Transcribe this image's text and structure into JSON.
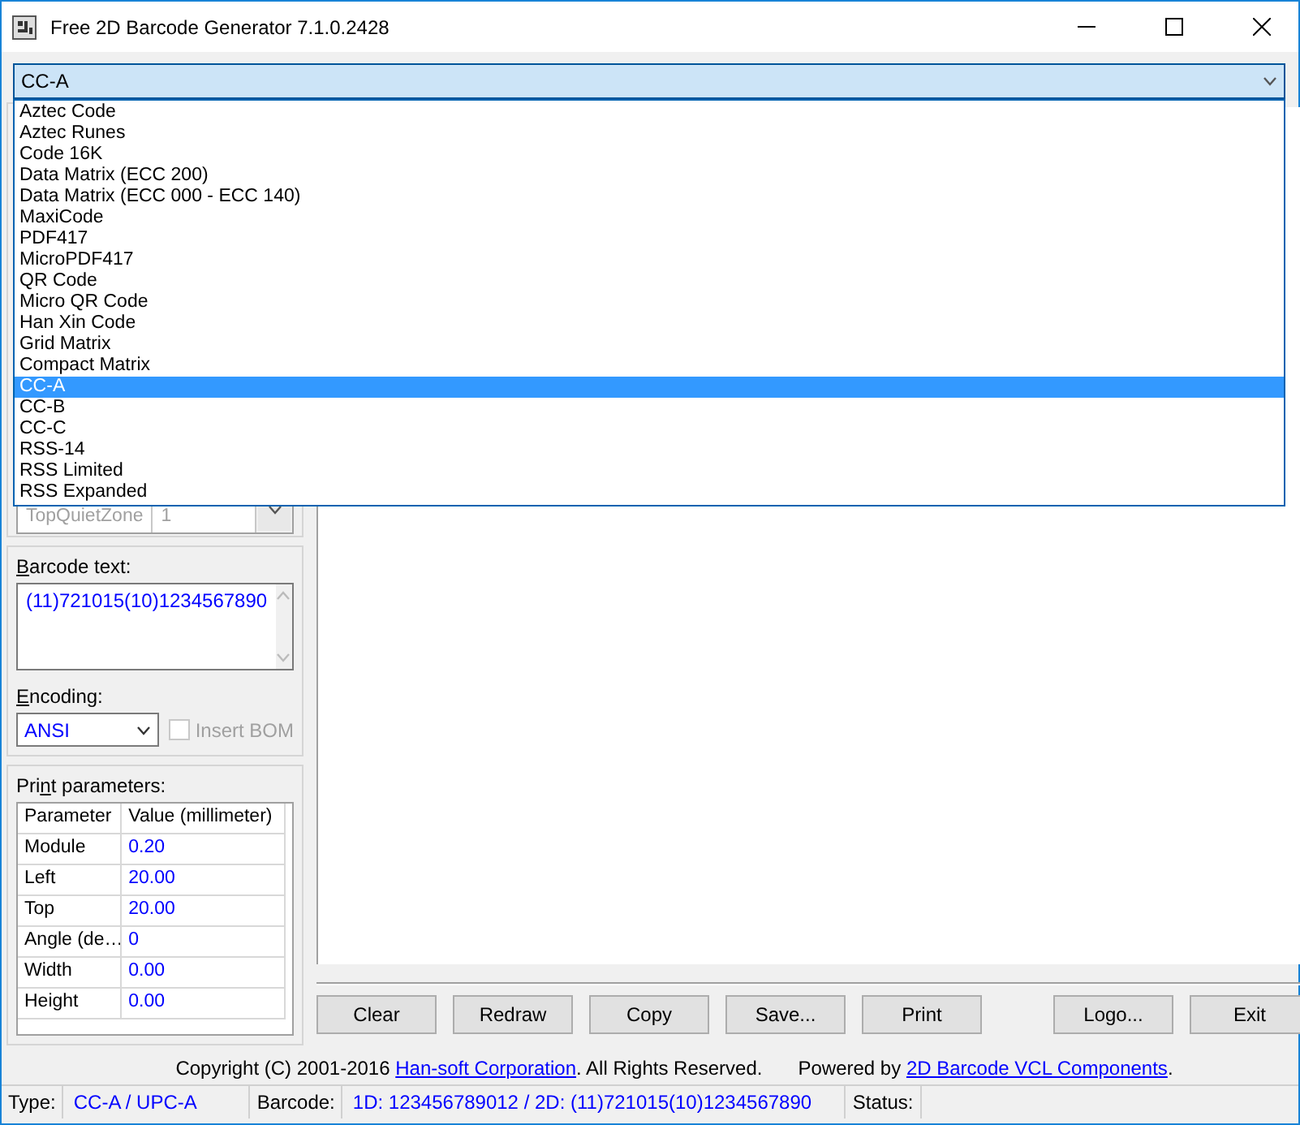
{
  "window": {
    "title": "Free 2D Barcode Generator 7.1.0.2428"
  },
  "barcode_type": {
    "value": "CC-A",
    "options": [
      {
        "label": "Aztec Code",
        "selected": false
      },
      {
        "label": "Aztec Runes",
        "selected": false
      },
      {
        "label": "Code 16K",
        "selected": false
      },
      {
        "label": "Data Matrix (ECC 200)",
        "selected": false
      },
      {
        "label": "Data Matrix (ECC 000 - ECC 140)",
        "selected": false
      },
      {
        "label": "MaxiCode",
        "selected": false
      },
      {
        "label": "PDF417",
        "selected": false
      },
      {
        "label": "MicroPDF417",
        "selected": false
      },
      {
        "label": "QR Code",
        "selected": false
      },
      {
        "label": "Micro QR Code",
        "selected": false
      },
      {
        "label": "Han Xin Code",
        "selected": false
      },
      {
        "label": "Grid Matrix",
        "selected": false
      },
      {
        "label": "Compact Matrix",
        "selected": false
      },
      {
        "label": "CC-A",
        "selected": true
      },
      {
        "label": "CC-B",
        "selected": false
      },
      {
        "label": "CC-C",
        "selected": false
      },
      {
        "label": "RSS-14",
        "selected": false
      },
      {
        "label": "RSS Limited",
        "selected": false
      },
      {
        "label": "RSS Expanded",
        "selected": false
      }
    ]
  },
  "symbology_grid": {
    "rows": [
      {
        "name": "TopQuietZone",
        "value": "1"
      }
    ]
  },
  "barcode_text": {
    "label": [
      {
        "text": "B",
        "underlined": true
      },
      {
        "text": "arcode text:",
        "underlined": false
      }
    ],
    "value": "(11)721015(10)1234567890"
  },
  "encoding": {
    "label": [
      {
        "text": "E",
        "underlined": true
      },
      {
        "text": "ncoding:",
        "underlined": false
      }
    ],
    "value": "ANSI",
    "insert_bom": {
      "label": "Insert BOM",
      "checked": false,
      "disabled": true
    }
  },
  "print_parameters": {
    "label": [
      {
        "text": "Pri",
        "underlined": false
      },
      {
        "text": "n",
        "underlined": true
      },
      {
        "text": "t parameters:",
        "underlined": false
      }
    ],
    "columns": [
      "Parameter",
      "Value (millimeter)"
    ],
    "rows": [
      [
        "Module",
        "0.20"
      ],
      [
        "Left",
        "20.00"
      ],
      [
        "Top",
        "20.00"
      ],
      [
        "Angle (de…",
        "0"
      ],
      [
        "Width",
        "0.00"
      ],
      [
        "Height",
        "0.00"
      ]
    ]
  },
  "buttons": [
    {
      "label": "Clear",
      "disabled": false
    },
    {
      "label": "Redraw",
      "disabled": false
    },
    {
      "label": "Copy",
      "disabled": false
    },
    {
      "label": "Save...",
      "disabled": false
    },
    {
      "label": "Print",
      "disabled": false
    },
    {
      "label": "Logo...",
      "disabled": false
    },
    {
      "label": "Exit",
      "disabled": false
    }
  ],
  "copyright": {
    "before": "Copyright (C) 2001-2016",
    "link": "Han-soft Corporation",
    "after": ". All Rights Reserved."
  },
  "powered_by": {
    "before": "Powered by",
    "link": "2D Barcode VCL Components",
    "after": "."
  },
  "status_bar": [
    {
      "label": "Type:",
      "value": "CC-A / UPC-A"
    },
    {
      "label": "Barcode:",
      "value": "1D: 123456789012 / 2D: (11)721015(10)1234567890"
    },
    {
      "label": "Status:"
    }
  ]
}
